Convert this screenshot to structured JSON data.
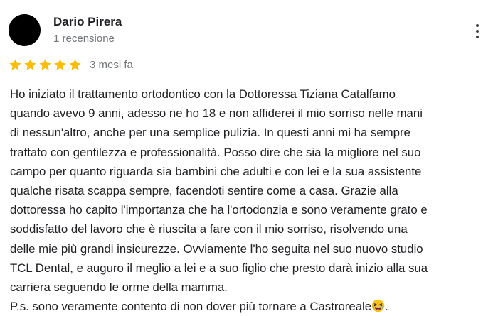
{
  "review": {
    "author_name": "Dario Pirera",
    "author_meta": "1 recensione",
    "rating": 5,
    "rating_max": 5,
    "date": "3 mesi fa",
    "text_lines": [
      "Ho iniziato il trattamento ortodontico con la Dottoressa Tiziana Catalfamo",
      "quando avevo 9 anni, adesso ne ho 18 e non affiderei il mio sorriso nelle mani",
      "di nessun'altro, anche per una semplice pulizia. In questi anni mi ha sempre",
      "trattato con gentilezza e professionalità. Posso dire che sia la migliore nel suo",
      "campo per quanto riguarda sia bambini che adulti e con lei e la sua assistente",
      "qualche risata scappa sempre, facendoti sentire come a casa. Grazie alla",
      "dottoressa ho capito l'importanza che ha l'ortodonzia e sono veramente grato e",
      "soddisfatto del lavoro che è riuscita a fare con il mio sorriso, risolvendo una",
      "delle mie più grandi insicurezze. Ovviamente l'ho seguita nel suo nuovo studio",
      "TCL Dental, e auguro il meglio a lei e a suo figlio che presto darà inizio alla sua",
      "carriera seguendo le orme della mamma."
    ],
    "last_line_text": "P.s. sono veramente contento di non dover più tornare a Castroreale",
    "last_line_suffix": ".",
    "emoji_icon": "grinning-squinting-face-emoji"
  },
  "colors": {
    "star": "#fbbc04",
    "text": "#202124",
    "muted": "#70757a",
    "avatar": "#000000"
  },
  "icons": {
    "more": "more-vert-icon",
    "star": "star-icon"
  }
}
